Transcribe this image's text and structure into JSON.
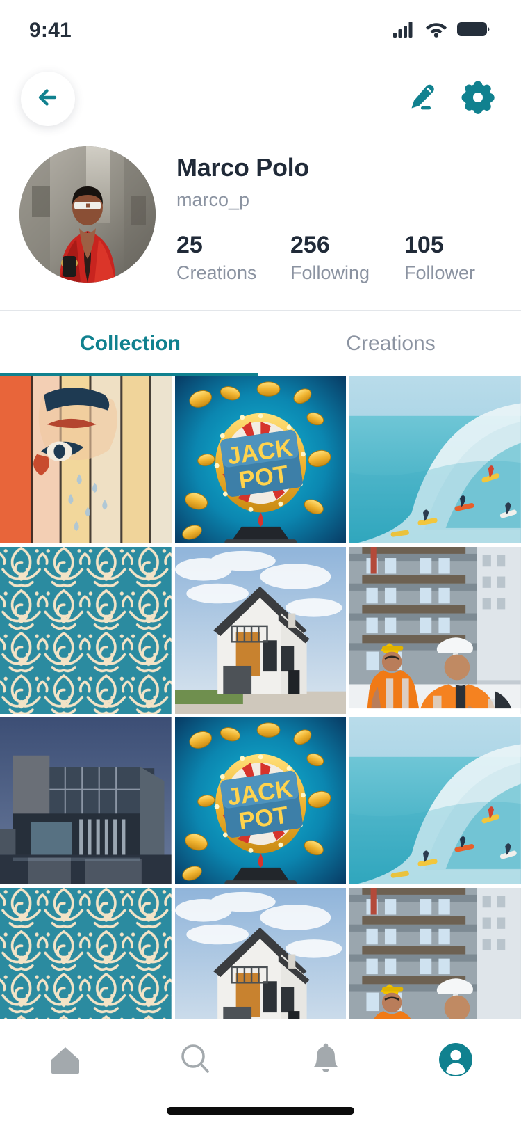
{
  "status_bar": {
    "time": "9:41",
    "cellular_icon": "cellular-signal-icon",
    "wifi_icon": "wifi-icon",
    "battery_icon": "battery-icon"
  },
  "top_bar": {
    "back_icon": "arrow-left-icon",
    "edit_icon": "edit-pencil-icon",
    "settings_icon": "gear-icon"
  },
  "profile": {
    "avatar_alt": "profile-photo",
    "display_name": "Marco Polo",
    "handle": "marco_p",
    "stats": [
      {
        "value": "25",
        "label": "Creations"
      },
      {
        "value": "256",
        "label": "Following"
      },
      {
        "value": "105",
        "label": "Follower"
      }
    ]
  },
  "tabs": {
    "items": [
      {
        "label": "Collection",
        "active": true
      },
      {
        "label": "Creations",
        "active": false
      }
    ]
  },
  "grid": {
    "cells": [
      {
        "kind": "mural",
        "caption": "Street art mural of a face on wooden planks"
      },
      {
        "kind": "jackpot",
        "caption": "Jackpot wheel with gold coins"
      },
      {
        "kind": "surf",
        "caption": "Surfers riding a large ocean wave"
      },
      {
        "kind": "pattern",
        "caption": "Teal floral damask pattern"
      },
      {
        "kind": "house",
        "caption": "Modern white house with gabled roof"
      },
      {
        "kind": "construction",
        "caption": "Two engineers in safety vests at a construction site"
      },
      {
        "kind": "building",
        "caption": "Modern glass office building at dusk"
      },
      {
        "kind": "jackpot",
        "caption": "Jackpot wheel with gold coins"
      },
      {
        "kind": "surf",
        "caption": "Surfers riding a large ocean wave"
      },
      {
        "kind": "pattern",
        "caption": "Teal floral damask pattern"
      },
      {
        "kind": "house",
        "caption": "Modern white house with gabled roof"
      },
      {
        "kind": "construction",
        "caption": "Two engineers in safety vests at a construction site"
      }
    ]
  },
  "bottom_nav": {
    "items": [
      {
        "icon": "home-icon",
        "active": false
      },
      {
        "icon": "search-icon",
        "active": false
      },
      {
        "icon": "bell-icon",
        "active": false
      },
      {
        "icon": "profile-icon",
        "active": true
      }
    ]
  },
  "colors": {
    "accent": "#10818f",
    "text_primary": "#202a38",
    "text_muted": "#8b93a1",
    "nav_inactive": "#a3a9ad",
    "divider": "#e3e6ea",
    "background": "#ffffff"
  }
}
